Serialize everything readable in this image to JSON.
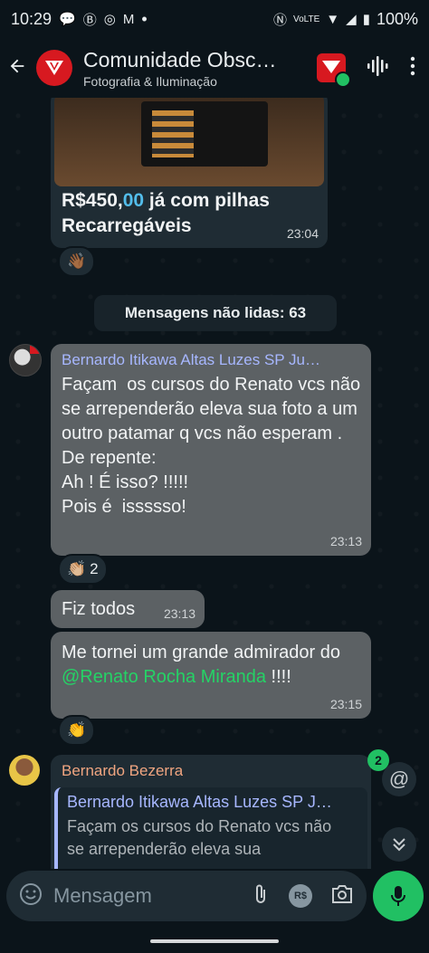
{
  "status_bar": {
    "time": "10:29",
    "dot": "•",
    "battery": "100%"
  },
  "header": {
    "title": "Comunidade Obsc…",
    "subtitle": "Fotografia & Iluminação"
  },
  "messages": {
    "m1": {
      "text": "R$450,00 já com pilhas\nRecarregáveis",
      "price_prefix": "R$450,",
      "price_cents": "00",
      "rest": " já com pilhas\nRecarregáveis",
      "time": "23:04",
      "reaction": "👋🏾"
    },
    "unread": "Mensagens não lidas: 63",
    "m2": {
      "sender": "Bernardo Itikawa Altas Luzes SP Ju…",
      "text": "Façam  os cursos do Renato vcs não se arrependerão eleva sua foto a um outro patamar q vcs não esperam .\nDe repente:\nAh ! É isso? !!!!!\nPois é  issssso!",
      "time": "23:13",
      "reaction": "👏🏼",
      "reaction_count": "2"
    },
    "m3": {
      "text": "Fiz todos",
      "time": "23:13"
    },
    "m4": {
      "text_before": "Me tornei um grande admirador do ",
      "mention": "@Renato Rocha Miranda",
      "text_after": " !!!!",
      "time": "23:15",
      "reaction": "👏"
    },
    "m5": {
      "sender": "Bernardo Bezerra",
      "quote_sender": "Bernardo Itikawa Altas Luzes SP J…",
      "quote_text": "Façam  os cursos do Renato vcs não se arrependerão eleva sua"
    }
  },
  "mention_badge": "2",
  "input": {
    "placeholder": "Mensagem"
  },
  "colors": {
    "accent": "#21c063",
    "bubble": "#5c6164",
    "background": "#0b141a"
  }
}
